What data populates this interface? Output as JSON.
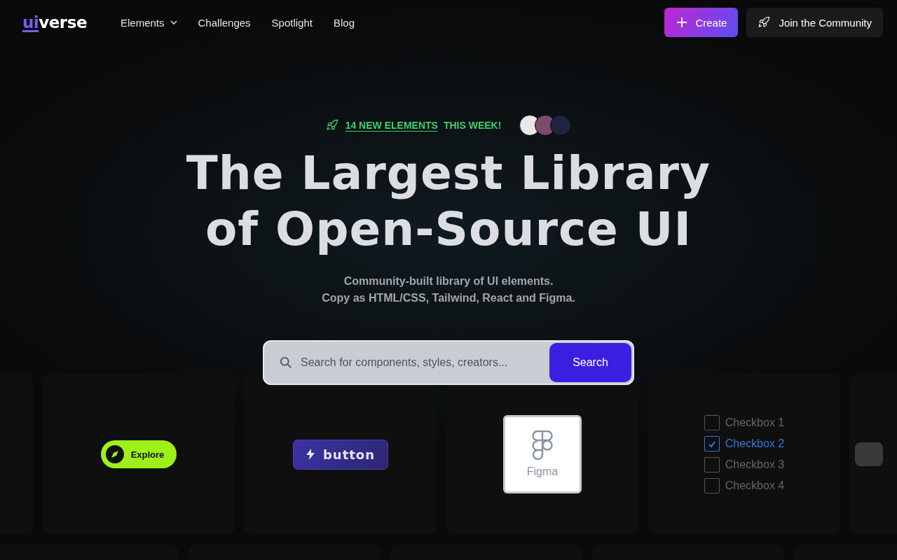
{
  "logo": {
    "accent": "ui",
    "rest": "verse"
  },
  "nav": [
    {
      "label": "Elements",
      "dropdown": true
    },
    {
      "label": "Challenges",
      "dropdown": false
    },
    {
      "label": "Spotlight",
      "dropdown": false
    },
    {
      "label": "Blog",
      "dropdown": false
    }
  ],
  "actions": [
    {
      "kind": "create",
      "label": "Create"
    },
    {
      "kind": "community",
      "label": "Join the Community"
    }
  ],
  "announcement": {
    "link": "14 NEW ELEMENTS",
    "text": "THIS WEEK!"
  },
  "headline": [
    "The Largest Library",
    "of Open-Source UI"
  ],
  "subtitle": [
    "Community-built library of UI elements.",
    "Copy as HTML/CSS, Tailwind, React and Figma."
  ],
  "search": {
    "placeholder": "Search for components, styles, creators...",
    "button": "Search"
  },
  "cards_row_1": [
    {
      "kind": "empty"
    },
    {
      "kind": "explore",
      "label": "Explore"
    },
    {
      "kind": "bolt",
      "label": "button"
    },
    {
      "kind": "figma",
      "label": "Figma"
    },
    {
      "kind": "checkboxes",
      "items": [
        {
          "label": "Checkbox 1",
          "checked": false
        },
        {
          "label": "Checkbox 2",
          "checked": true
        },
        {
          "label": "Checkbox 3",
          "checked": false
        },
        {
          "label": "Checkbox 4",
          "checked": false
        }
      ]
    },
    {
      "kind": "partial"
    }
  ]
}
